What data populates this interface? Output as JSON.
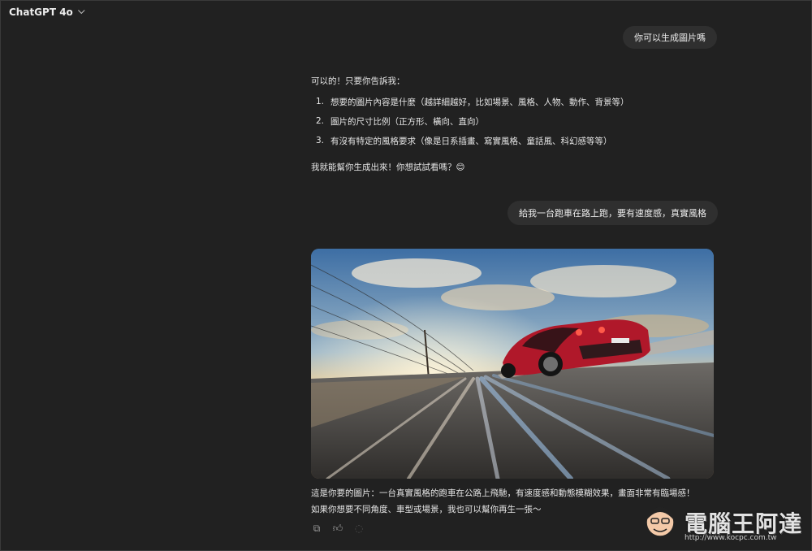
{
  "header": {
    "model_label": "ChatGPT 4o"
  },
  "messages": {
    "user_1": "你可以生成圖片嗎",
    "assistant_1": {
      "intro": "可以的！只要你告訴我：",
      "items": [
        {
          "num": "1.",
          "text": "想要的圖片內容是什麼（越詳細越好，比如場景、風格、人物、動作、背景等）"
        },
        {
          "num": "2.",
          "text": "圖片的尺寸比例（正方形、橫向、直向）"
        },
        {
          "num": "3.",
          "text": "有沒有特定的風格要求（像是日系插畫、寫實風格、童話風、科幻感等等）"
        }
      ],
      "outro": "我就能幫你生成出來！你想試試看嗎？😊"
    },
    "user_2": "給我一台跑車在路上跑，要有速度感，真實風格",
    "assistant_2": {
      "caption_line_1": "這是你要的圖片：一台真實風格的跑車在公路上飛馳，有速度感和動態模糊效果，畫面非常有臨場感！",
      "caption_line_2": "如果你想要不同角度、車型或場景，我也可以幫你再生一張～"
    }
  },
  "watermark": {
    "text": "電腦王阿達",
    "url": "http://www.kocpc.com.tw"
  },
  "colors": {
    "background": "#212121",
    "bubble": "#2f2f2f",
    "text": "#ececec",
    "car": "#b0182a"
  }
}
